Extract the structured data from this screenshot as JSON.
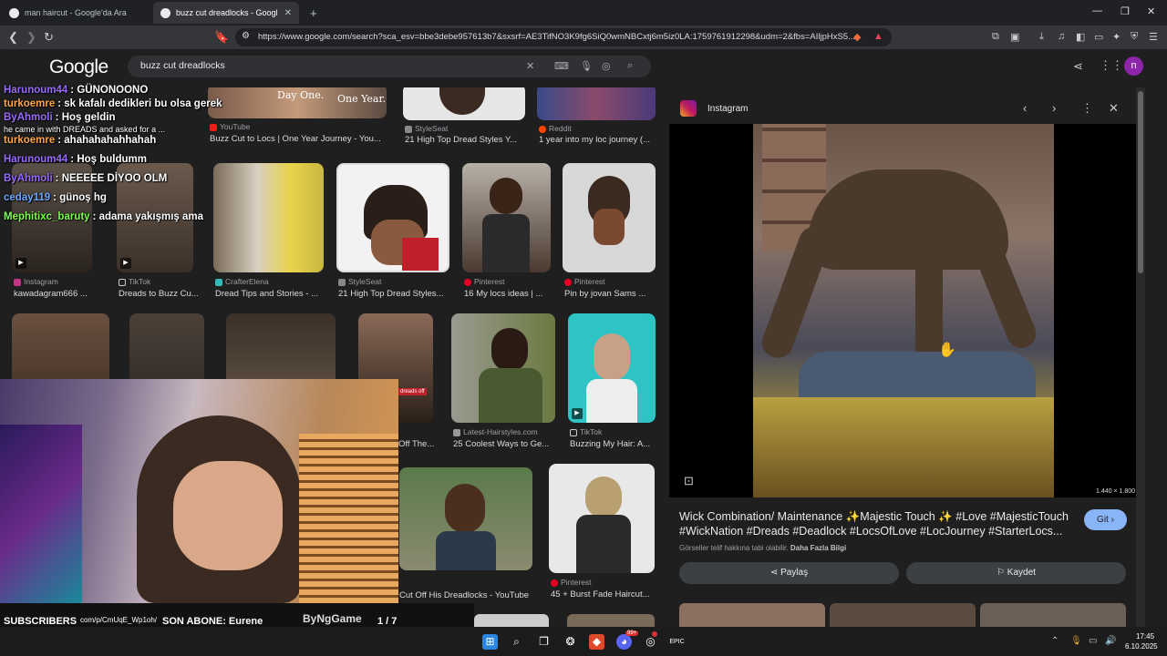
{
  "tabs": [
    {
      "title": "man haircut - Google'da Ara"
    },
    {
      "title": "buzz cut dreadlocks - Google'da"
    }
  ],
  "new_tab_symbol": "+",
  "address": {
    "url": "https://www.google.com/search?sca_esv=bbe3debe957613b7&sxsrf=AE3TifNO3K9fg6SiQ0wmNBCxtj6m5iz0LA:1759761912298&udm=2&fbs=AIljpHxS5..."
  },
  "google": {
    "logo": "Google",
    "query": "buzz cut dreadlocks",
    "avatar_letter": "n"
  },
  "results": [
    {
      "source": "YouTube",
      "title": "Buzz Cut to Locs | One Year Journey - You...",
      "overlay1": "Day One.",
      "overlay2": "One Year."
    },
    {
      "source": "StyleSeat",
      "title": "21 High Top Dread Styles Y..."
    },
    {
      "source": "Reddit",
      "title": "1 year into my loc journey (..."
    },
    {
      "source": "Instagram",
      "title": "kawadagram666 ..."
    },
    {
      "source": "TikTok",
      "title": "Dreads to Buzz Cu..."
    },
    {
      "source": "CrafterElena",
      "title": "Dread Tips and Stories - ..."
    },
    {
      "source": "StyleSeat",
      "title": "21 High Top Dread Styles..."
    },
    {
      "source": "Pinterest",
      "title": "16 My locs ideas | ..."
    },
    {
      "source": "Pinterest",
      "title": "Pin by jovan Sams ..."
    },
    {
      "source": "Latest-Hairstyles.com",
      "title": "25 Coolest Ways to Ge..."
    },
    {
      "source": "TikTok",
      "title": "Buzzing My Hair: A..."
    },
    {
      "source": "",
      "title": "Off The..."
    },
    {
      "source": "",
      "title": "Cut Off His Dreadlocks - YouTube"
    },
    {
      "source": "Pinterest",
      "title": "45 + Burst Fade Haircut..."
    }
  ],
  "chat": [
    {
      "user": "Harunoum44",
      "msg": ": GÜNONOONO",
      "user_color": "#9b6bff"
    },
    {
      "user": "turkoemre",
      "msg": ": sk kafalı dedikleri bu olsa gerek",
      "user_color": "#ffa64d"
    },
    {
      "user": "ByAhmoli",
      "msg": ": Hoş geldin",
      "user_color": "#9b6bff"
    },
    {
      "sub": "he came in with DREADS and asked for a ..."
    },
    {
      "user": "turkoemre",
      "msg": ": ahahahahahhahah",
      "user_color": "#ffa64d"
    },
    {
      "user": "Harunoum44",
      "msg": ": Hoş buldumm",
      "user_color": "#9b6bff"
    },
    {
      "user": "ByAhmoli",
      "msg": ": NEEEEE DİYOO OLM",
      "user_color": "#9b6bff"
    },
    {
      "user": "ceday119",
      "msg": ": günoş hg",
      "user_color": "#6aa9ff"
    },
    {
      "user": "Mephitixc_baruty",
      "msg": ": adama yakışmış ama",
      "user_color": "#7cff4f"
    }
  ],
  "stream_overlay": {
    "subscribers": "SUBSCRIBERS",
    "link": "com/p/CmUqE_Wp1oh/",
    "last_sub": "SON ABONE: Eurene",
    "brand": "ByNgGame",
    "page": "1 / 7",
    "dreads_off": "dreads off"
  },
  "panel": {
    "source": "Instagram",
    "description": "Wick Combination/ Maintenance ✨Majestic Touch ✨ #Love #MajesticTouch #WickNation #Dreads #Deadlock #LocsOfLove #LocJourney #StarterLocs...",
    "git": "Git",
    "copyright": "Görseller telif hakkına tabi olabilir.",
    "more_info": "Daha Fazla Bilgi",
    "dims": "1.440 × 1.800",
    "share": "Paylaş",
    "save": "Kaydet"
  },
  "taskbar": {
    "time": "17:45",
    "date": "6.10.2025",
    "discord_badge": "99+"
  }
}
